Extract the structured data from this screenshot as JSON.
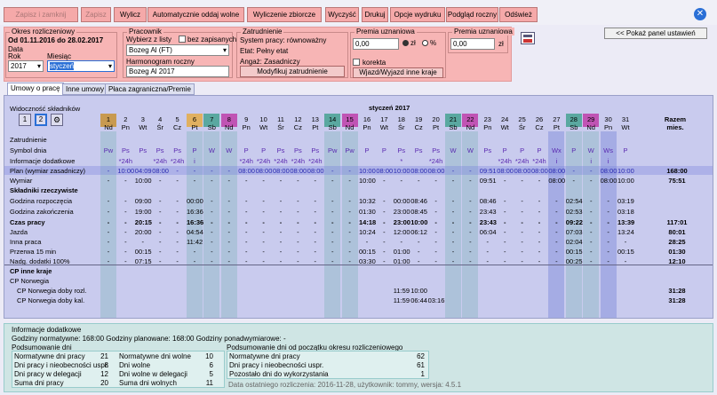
{
  "toolbar": {
    "buttons": [
      "Zapisz i zamknij",
      "Zapisz",
      "Wylicz",
      "Automatycznie oddaj wolne",
      "Wyliczenie zbiorcze",
      "Wyczyść",
      "Drukuj",
      "Opcje wydruku",
      "Podgląd roczny",
      "Odśwież"
    ],
    "close_icon": "close-icon"
  },
  "okres": {
    "legend": "Okres rozliczeniowy",
    "range": "Od 01.11.2016 do 28.02.2017",
    "data_label": "Data",
    "rok_label": "Rok",
    "miesiac_label": "Miesiąc",
    "rok": "2017",
    "miesiac": "styczeń"
  },
  "pracownik": {
    "legend": "Pracownik",
    "wybierz_label": "Wybierz z listy",
    "bez_zapisanych": "bez zapisanych",
    "employee": "Bozeg Al (FT)",
    "harmonogram_label": "Harmonogram roczny",
    "harmonogram": "Bozeg Al 2017"
  },
  "zatrudnienie": {
    "legend": "Zatrudnienie",
    "system": "System pracy: równoważny",
    "etat": "Etat: Pełny etat",
    "angaz": "Angaż: Zasadniczy",
    "modify": "Modyfikuj zatrudnienie"
  },
  "premia1": {
    "legend": "Premia uznaniowa",
    "value": "0,00",
    "zl": "zł",
    "pct": "%",
    "korekta": "korekta",
    "wjazd": "Wjazd/Wyjazd inne kraje"
  },
  "premia2": {
    "legend": "Premia uznaniowa",
    "value": "0,00",
    "zl": "zł"
  },
  "panel_btn": "<< Pokaż panel ustawień",
  "tabs": [
    "Umowy o pracę",
    "Inne umowy",
    "Płaca zagraniczna/Premie"
  ],
  "grid": {
    "widocznosc": "Widoczność składników",
    "btn1": "1",
    "btn2": "2",
    "month": "styczeń 2017",
    "razem": "Razem mies.",
    "days": [
      "1",
      "2",
      "3",
      "4",
      "5",
      "6",
      "7",
      "8",
      "9",
      "10",
      "11",
      "12",
      "13",
      "14",
      "15",
      "16",
      "17",
      "18",
      "19",
      "20",
      "21",
      "22",
      "23",
      "24",
      "25",
      "26",
      "27",
      "28",
      "29",
      "30",
      "31"
    ],
    "dows": [
      "Nd",
      "Pn",
      "Wt",
      "Śr",
      "Cz",
      "Pt",
      "Sb",
      "Nd",
      "Pn",
      "Wt",
      "Śr",
      "Cz",
      "Pt",
      "Sb",
      "Nd",
      "Pn",
      "Wt",
      "Śr",
      "Cz",
      "Pt",
      "Sb",
      "Nd",
      "Pn",
      "Wt",
      "Śr",
      "Cz",
      "Pt",
      "Sb",
      "Nd",
      "Pn",
      "Wt"
    ],
    "rows": [
      {
        "label": "Zatrudnienie",
        "bold": false,
        "cells": [],
        "total": ""
      },
      {
        "label": "Symbol dnia",
        "bold": false,
        "cells": [
          "Pw",
          "Ps",
          "Ps",
          "Ps",
          "Ps",
          "P",
          "W",
          "W",
          "P",
          "P",
          "Ps",
          "Ps",
          "Ps",
          "Pw",
          "Pw",
          "P",
          "P",
          "Ps",
          "Ps",
          "Ps",
          "W",
          "W",
          "Ps",
          "P",
          "P",
          "P",
          "Wx",
          "P",
          "W",
          "Ws",
          "P"
        ],
        "total": ""
      },
      {
        "label": "Informacje dodatkowe",
        "bold": false,
        "cells": [
          "",
          "*24h",
          "",
          "*24h",
          "*24h",
          "i",
          "",
          "",
          "*24h",
          "*24h",
          "*24h",
          "*24h",
          "*24h",
          "",
          "",
          "",
          "",
          "*",
          "",
          "*24h",
          "",
          "",
          "",
          "*24h",
          "*24h",
          "*24h",
          "i",
          "",
          "i",
          "i",
          ""
        ],
        "total": ""
      },
      {
        "label": "Plan (wymiar zasadniczy)",
        "bold": false,
        "cells": [
          "-",
          "10:00",
          "04:09",
          "08:00",
          "-",
          "-",
          "-",
          "-",
          "08:00",
          "08:00",
          "08:00",
          "08:00",
          "08:00",
          "-",
          "-",
          "10:00",
          "08:00",
          "10:00",
          "08:00",
          "08:00",
          "-",
          "-",
          "09:51",
          "08:00",
          "08:00",
          "08:00",
          "08:00",
          "-",
          "-",
          "08:00",
          "10:00"
        ],
        "total": "168:00"
      },
      {
        "label": "Wymiar",
        "bold": false,
        "cells": [
          "-",
          "-",
          "10:00",
          "-",
          "-",
          "-",
          "-",
          "-",
          "-",
          "-",
          "-",
          "-",
          "-",
          "-",
          "-",
          "10:00",
          "-",
          "-",
          "-",
          "-",
          "-",
          "-",
          "09:51",
          "-",
          "-",
          "-",
          "08:00",
          "-",
          "-",
          "08:00",
          "10:00"
        ],
        "total": "75:51"
      },
      {
        "label": "Składniki rzeczywiste",
        "bold": true,
        "cells": [],
        "total": ""
      },
      {
        "label": "Godzina rozpoczęcia",
        "bold": false,
        "cells": [
          "-",
          "-",
          "09:00",
          "-",
          "-",
          "00:00",
          "-",
          "-",
          "-",
          "-",
          "-",
          "-",
          "-",
          "-",
          "-",
          "10:32",
          "-",
          "00:00",
          "08:46",
          "-",
          "-",
          "-",
          "08:46",
          "-",
          "-",
          "-",
          "-",
          "02:54",
          "-",
          "-",
          "03:19"
        ],
        "total": ""
      },
      {
        "label": "Godzina zakończenia",
        "bold": false,
        "cells": [
          "-",
          "-",
          "19:00",
          "-",
          "-",
          "16:36",
          "-",
          "-",
          "-",
          "-",
          "-",
          "-",
          "-",
          "-",
          "-",
          "01:30",
          "-",
          "23:00",
          "08:45",
          "-",
          "-",
          "-",
          "23:43",
          "-",
          "-",
          "-",
          "-",
          "02:53",
          "-",
          "-",
          "03:18"
        ],
        "total": ""
      },
      {
        "label": "Czas pracy",
        "bold": true,
        "cells": [
          "-",
          "-",
          "20:15",
          "-",
          "-",
          "16:36",
          "-",
          "-",
          "-",
          "-",
          "-",
          "-",
          "-",
          "-",
          "-",
          "14:18",
          "-",
          "23:00",
          "10:00",
          "-",
          "-",
          "-",
          "23:43",
          "-",
          "-",
          "-",
          "-",
          "09:22",
          "-",
          "-",
          "13:39"
        ],
        "total": "117:01"
      },
      {
        "label": "Jazda",
        "bold": false,
        "cells": [
          "-",
          "-",
          "20:00",
          "-",
          "-",
          "04:54",
          "-",
          "-",
          "-",
          "-",
          "-",
          "-",
          "-",
          "-",
          "-",
          "10:24",
          "-",
          "12:00",
          "06:12",
          "-",
          "-",
          "-",
          "06:04",
          "-",
          "-",
          "-",
          "-",
          "07:03",
          "-",
          "-",
          "13:24"
        ],
        "total": "80:01"
      },
      {
        "label": "Inna praca",
        "bold": false,
        "cells": [
          "-",
          "-",
          "-",
          "-",
          "-",
          "11:42",
          "-",
          "-",
          "-",
          "-",
          "-",
          "-",
          "-",
          "-",
          "-",
          "-",
          "-",
          "-",
          "-",
          "-",
          "-",
          "-",
          "-",
          "-",
          "-",
          "-",
          "-",
          "02:04",
          "-",
          "-",
          "-"
        ],
        "total": "28:25"
      },
      {
        "label": "Przerwa 15 min",
        "bold": false,
        "cells": [
          "-",
          "-",
          "00:15",
          "-",
          "-",
          "-",
          "-",
          "-",
          "-",
          "-",
          "-",
          "-",
          "-",
          "-",
          "-",
          "00:15",
          "-",
          "01:00",
          "-",
          "-",
          "-",
          "-",
          "-",
          "-",
          "-",
          "-",
          "-",
          "00:15",
          "-",
          "-",
          "00:15"
        ],
        "total": "01:30"
      },
      {
        "label": "Nadg. dodatki 100%",
        "bold": false,
        "cells": [
          "-",
          "-",
          "07:15",
          "-",
          "-",
          "-",
          "-",
          "-",
          "-",
          "-",
          "-",
          "-",
          "-",
          "-",
          "-",
          "03:30",
          "-",
          "01:00",
          "-",
          "-",
          "-",
          "-",
          "-",
          "-",
          "-",
          "-",
          "-",
          "00:25",
          "-",
          "-",
          "-"
        ],
        "total": "12:10"
      },
      {
        "label": "CP inne kraje",
        "bold": true,
        "cells": [],
        "total": ""
      },
      {
        "label": "CP Norwegia",
        "bold": false,
        "cells": [],
        "total": ""
      },
      {
        "label": "CP Norwegia doby rozl.",
        "bold": false,
        "cells": [
          "",
          "",
          "",
          "",
          "",
          "",
          "",
          "",
          "",
          "",
          "",
          "",
          "",
          "",
          "",
          "",
          "",
          "11:59",
          "10:00",
          "",
          "",
          "",
          "",
          "",
          "",
          "",
          "",
          "",
          "",
          "",
          ""
        ],
        "total": "31:28"
      },
      {
        "label": "CP Norwegia doby kal.",
        "bold": false,
        "cells": [
          "",
          "",
          "",
          "",
          "",
          "",
          "",
          "",
          "",
          "",
          "",
          "",
          "",
          "",
          "",
          "",
          "",
          "11:59",
          "06:44",
          "03:16",
          "",
          "",
          "",
          "",
          "",
          "",
          "",
          "",
          "",
          "",
          ""
        ],
        "total": "31:28"
      }
    ]
  },
  "info": {
    "legend": "Informacje dodatkowe",
    "godziny": "Godziny normatywne: 168:00   Godziny planowane: 168:00   Godziny ponadwymiarowe: -",
    "podsumowanie_left": "Podsumowanie dni",
    "podsumowanie_right": "Podsumowanie dni od początku okresu rozliczeniowego",
    "left_rows": [
      [
        "Normatywne dni pracy",
        "21",
        "Normatywne dni wolne",
        "10"
      ],
      [
        "Dni pracy i nieobecności uspr.",
        "8",
        "Dni wolne",
        "6"
      ],
      [
        "Dni pracy w delegacji",
        "12",
        "Dni wolne w delegacji",
        "5"
      ],
      [
        "Suma dni pracy",
        "20",
        "Suma dni wolnych",
        "11"
      ]
    ],
    "right_rows": [
      [
        "Normatywne dni pracy",
        "62"
      ],
      [
        "Dni pracy i nieobecności uspr.",
        "61"
      ],
      [
        "Pozostało dni do wykorzystania",
        "1"
      ]
    ],
    "footer": "Data ostatniego rozliczenia: 2016-11-28, użytkownik: tommy, wersja: 4.5.1"
  },
  "colors": {
    "weekend_sat": "#5aa8a0",
    "weekend_sun": "#c054b4",
    "friday": "#e0b060",
    "header_pink": "#f7b5b5"
  }
}
